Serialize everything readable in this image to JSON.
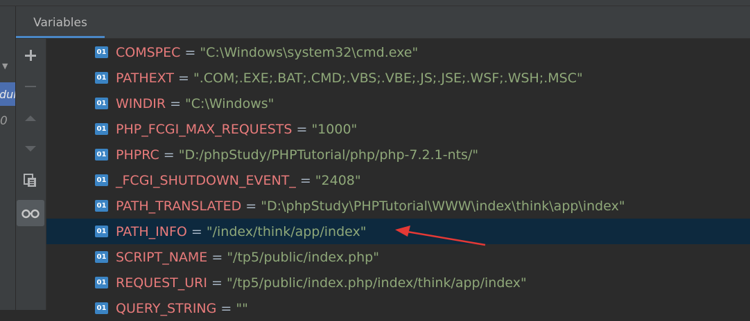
{
  "panel": {
    "tab_label": "Variables",
    "left_fragment": "duk",
    "left_zero": "0"
  },
  "toolbar": {
    "icons": [
      "add-icon",
      "remove-icon",
      "up-icon",
      "down-icon",
      "copy-icon",
      "watch-icon"
    ]
  },
  "variables": [
    {
      "name": "COMSPEC",
      "eq": " = ",
      "value": "\"C:\\Windows\\system32\\cmd.exe\""
    },
    {
      "name": "PATHEXT",
      "eq": " = ",
      "value": "\".COM;.EXE;.BAT;.CMD;.VBS;.VBE;.JS;.JSE;.WSF;.WSH;.MSC\""
    },
    {
      "name": "WINDIR",
      "eq": " = ",
      "value": "\"C:\\Windows\""
    },
    {
      "name": "PHP_FCGI_MAX_REQUESTS",
      "eq": " = ",
      "value": "\"1000\""
    },
    {
      "name": "PHPRC",
      "eq": " = ",
      "value": "\"D:/phpStudy/PHPTutorial/php/php-7.2.1-nts/\""
    },
    {
      "name": "_FCGI_SHUTDOWN_EVENT_",
      "eq": " = ",
      "value": "\"2408\""
    },
    {
      "name": "PATH_TRANSLATED",
      "eq": " = ",
      "value": "\"D:\\phpStudy\\PHPTutorial\\WWW\\index\\think\\app\\index\""
    },
    {
      "name": "PATH_INFO",
      "eq": " = ",
      "value": "\"/index/think/app/index\""
    },
    {
      "name": "SCRIPT_NAME",
      "eq": " = ",
      "value": "\"/tp5/public/index.php\""
    },
    {
      "name": "REQUEST_URI",
      "eq": " = ",
      "value": "\"/tp5/public/index.php/index/think/app/index\""
    },
    {
      "name": "QUERY_STRING",
      "eq": " = ",
      "value": "\"\""
    }
  ],
  "badge_text": "01",
  "colors": {
    "selected_row": "#0d293e",
    "var_name": "#e87b7b",
    "string_value": "#8fa879",
    "badge": "#3b84c4",
    "annotation_arrow": "#e53935"
  }
}
